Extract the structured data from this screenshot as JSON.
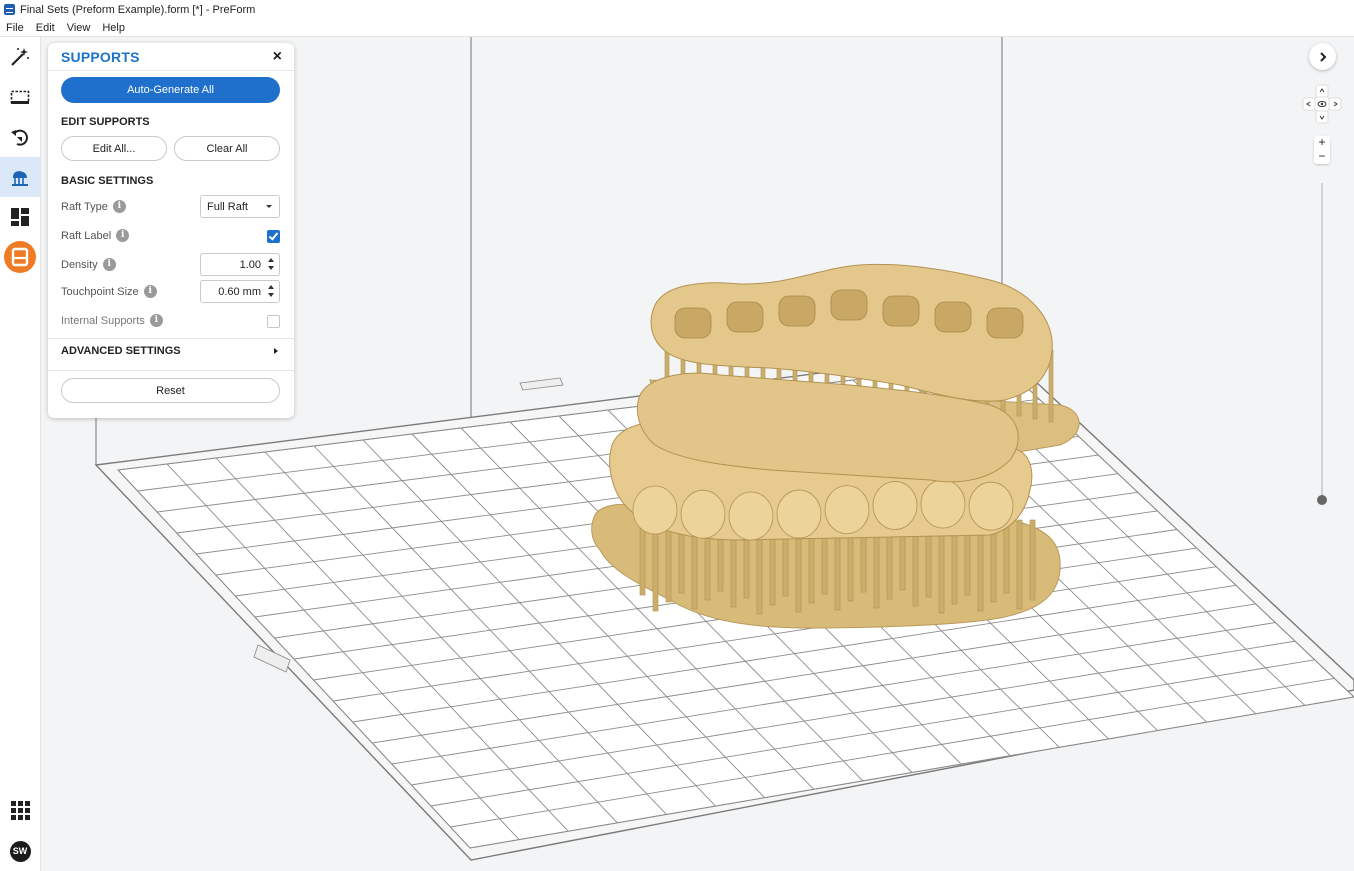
{
  "window": {
    "title": "Final Sets (Preform Example).form [*] - PreForm"
  },
  "menu": [
    "File",
    "Edit",
    "View",
    "Help"
  ],
  "toolbar": {
    "tools": [
      "magic-wand-icon",
      "selection-box-icon",
      "orientation-icon",
      "supports-icon",
      "layout-icon",
      "printer-icon"
    ],
    "bottom": {
      "apps": "apps-grid-icon",
      "avatar_initials": "SW"
    }
  },
  "supports_panel": {
    "title": "SUPPORTS",
    "close": "×",
    "auto_generate_label": "Auto-Generate All",
    "edit_supports": {
      "heading": "EDIT SUPPORTS",
      "edit_all_label": "Edit All...",
      "clear_all_label": "Clear All"
    },
    "basic_settings": {
      "heading": "BASIC SETTINGS",
      "raft_type": {
        "label": "Raft Type",
        "value": "Full Raft"
      },
      "raft_label": {
        "label": "Raft Label",
        "checked": true
      },
      "density": {
        "label": "Density",
        "value": "1.00"
      },
      "touchpoint_size": {
        "label": "Touchpoint Size",
        "value": "0.60 mm"
      },
      "internal_supports": {
        "label": "Internal Supports",
        "checked": false
      }
    },
    "advanced_settings": {
      "heading": "ADVANCED SETTINGS"
    },
    "reset_label": "Reset"
  },
  "viewport": {
    "zoom_in": "+",
    "zoom_out": "−",
    "layer_slider_level": 1.0,
    "accent_colors": {
      "accent": "#1f6fcc",
      "model": "#e2c689",
      "printer_orange": "#f07b25"
    }
  }
}
